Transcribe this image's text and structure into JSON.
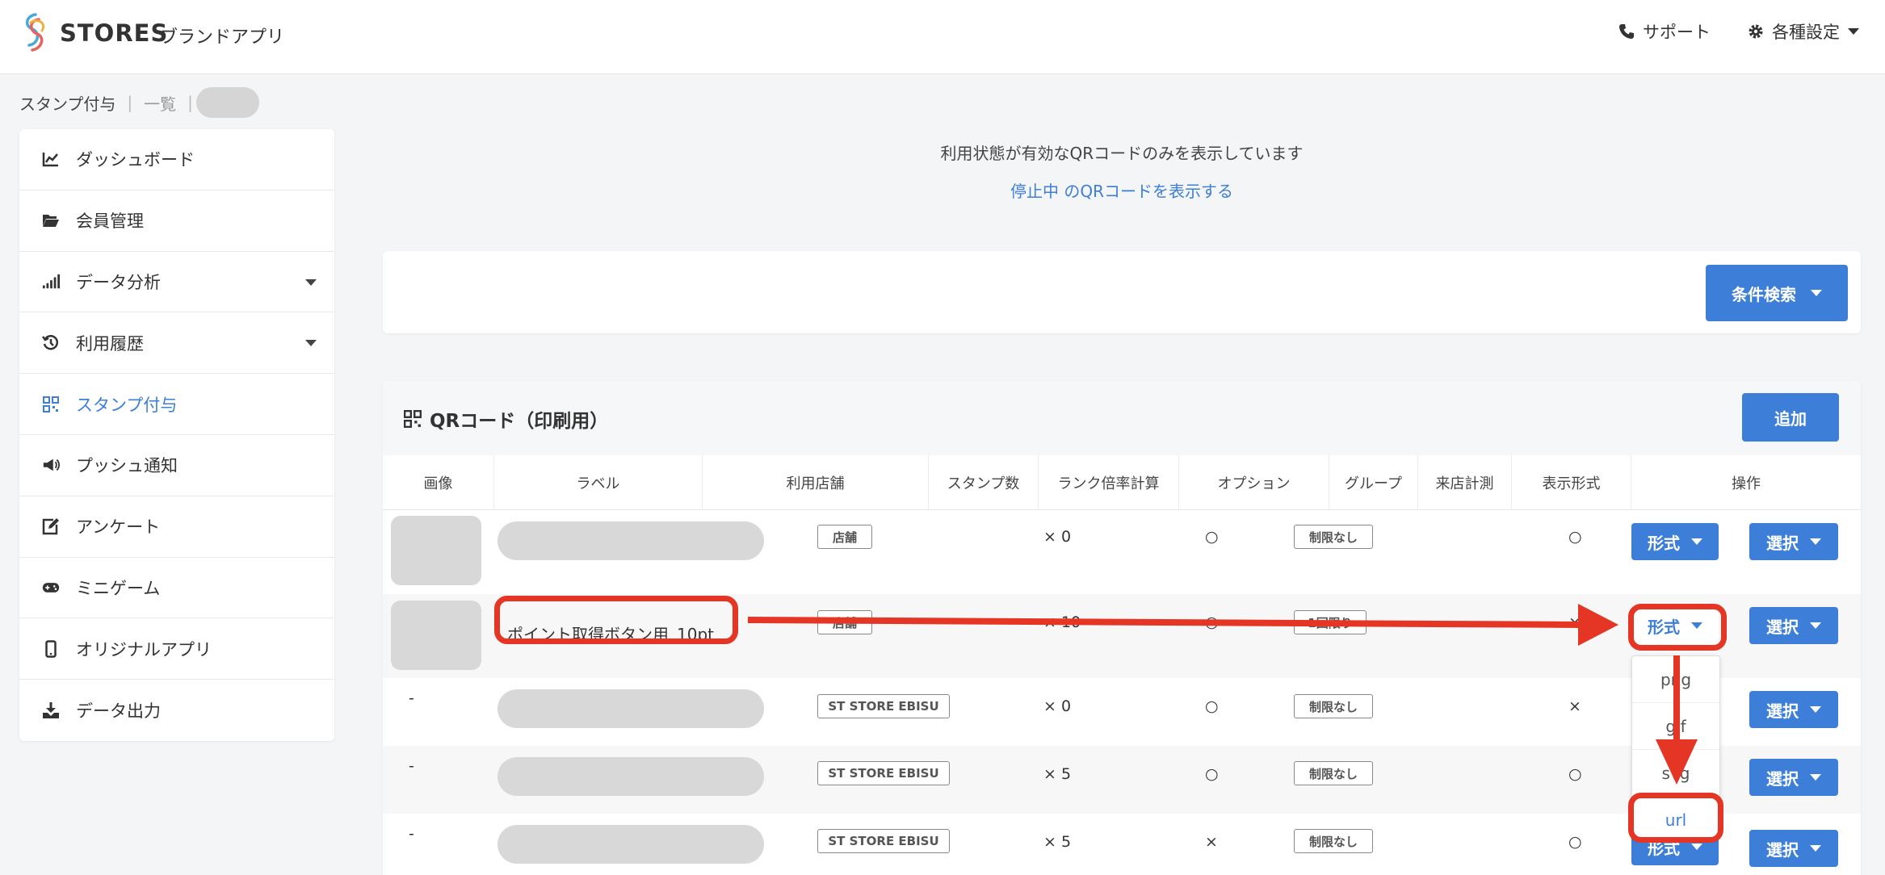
{
  "header": {
    "brand": "STORES",
    "brand_sub": "ブランドアプリ",
    "support": "サポート",
    "settings": "各種設定"
  },
  "breadcrumb": {
    "item1": "スタンプ付与",
    "sep": "|",
    "item2": "一覧"
  },
  "sidebar": {
    "items": [
      {
        "label": "ダッシュボード",
        "icon": "chart-line-icon"
      },
      {
        "label": "会員管理",
        "icon": "folder-icon"
      },
      {
        "label": "データ分析",
        "icon": "signal-bars-icon",
        "expandable": true
      },
      {
        "label": "利用履歴",
        "icon": "history-icon",
        "expandable": true
      },
      {
        "label": "スタンプ付与",
        "icon": "qrcode-icon",
        "active": true
      },
      {
        "label": "プッシュ通知",
        "icon": "megaphone-icon"
      },
      {
        "label": "アンケート",
        "icon": "edit-icon"
      },
      {
        "label": "ミニゲーム",
        "icon": "gamepad-icon"
      },
      {
        "label": "オリジナルアプリ",
        "icon": "mobile-icon"
      },
      {
        "label": "データ出力",
        "icon": "download-icon"
      }
    ]
  },
  "notice": {
    "line1": "利用状態が有効なQRコードのみを表示しています",
    "link": "停止中 のQRコードを表示する"
  },
  "filter": {
    "button": "条件検索"
  },
  "qr": {
    "title": "QRコード（印刷用）",
    "add": "追加",
    "columns": [
      "画像",
      "ラベル",
      "利用店舗",
      "スタンプ数",
      "ランク倍率計算",
      "オプション",
      "グループ",
      "来店計測",
      "表示形式",
      "操作"
    ],
    "rows": [
      {
        "image": "",
        "label": "",
        "store": "店舗",
        "stamps": "× 0",
        "rank": "○",
        "option": "制限なし",
        "group": "",
        "visit": "○",
        "format": "形式",
        "action": "選択"
      },
      {
        "image": "",
        "label": "ポイント取得ボタン用_10pt",
        "store": "店舗",
        "stamps": "× 10",
        "rank": "○",
        "option": "1回限り",
        "group": "",
        "visit": "×",
        "format": "形式",
        "action": "選択"
      },
      {
        "image": "-",
        "label": "",
        "store": "ST STORE EBISU",
        "stamps": "× 0",
        "rank": "○",
        "option": "制限なし",
        "group": "",
        "visit": "×",
        "format": "形式",
        "action": "選択"
      },
      {
        "image": "-",
        "label": "",
        "store": "ST STORE EBISU",
        "stamps": "× 5",
        "rank": "○",
        "option": "制限なし",
        "group": "",
        "visit": "○",
        "format": "形式",
        "action": "選択"
      },
      {
        "image": "-",
        "label": "",
        "store": "ST STORE EBISU",
        "stamps": "× 5",
        "rank": "×",
        "option": "制限なし",
        "group": "",
        "visit": "○",
        "format": "形式",
        "action": "選択"
      }
    ]
  },
  "format_dropdown": {
    "options": [
      "png",
      "gif",
      "svg",
      "url"
    ],
    "selected": "url"
  },
  "colors": {
    "accent": "#3d7fd8",
    "annotation": "#e53524"
  }
}
